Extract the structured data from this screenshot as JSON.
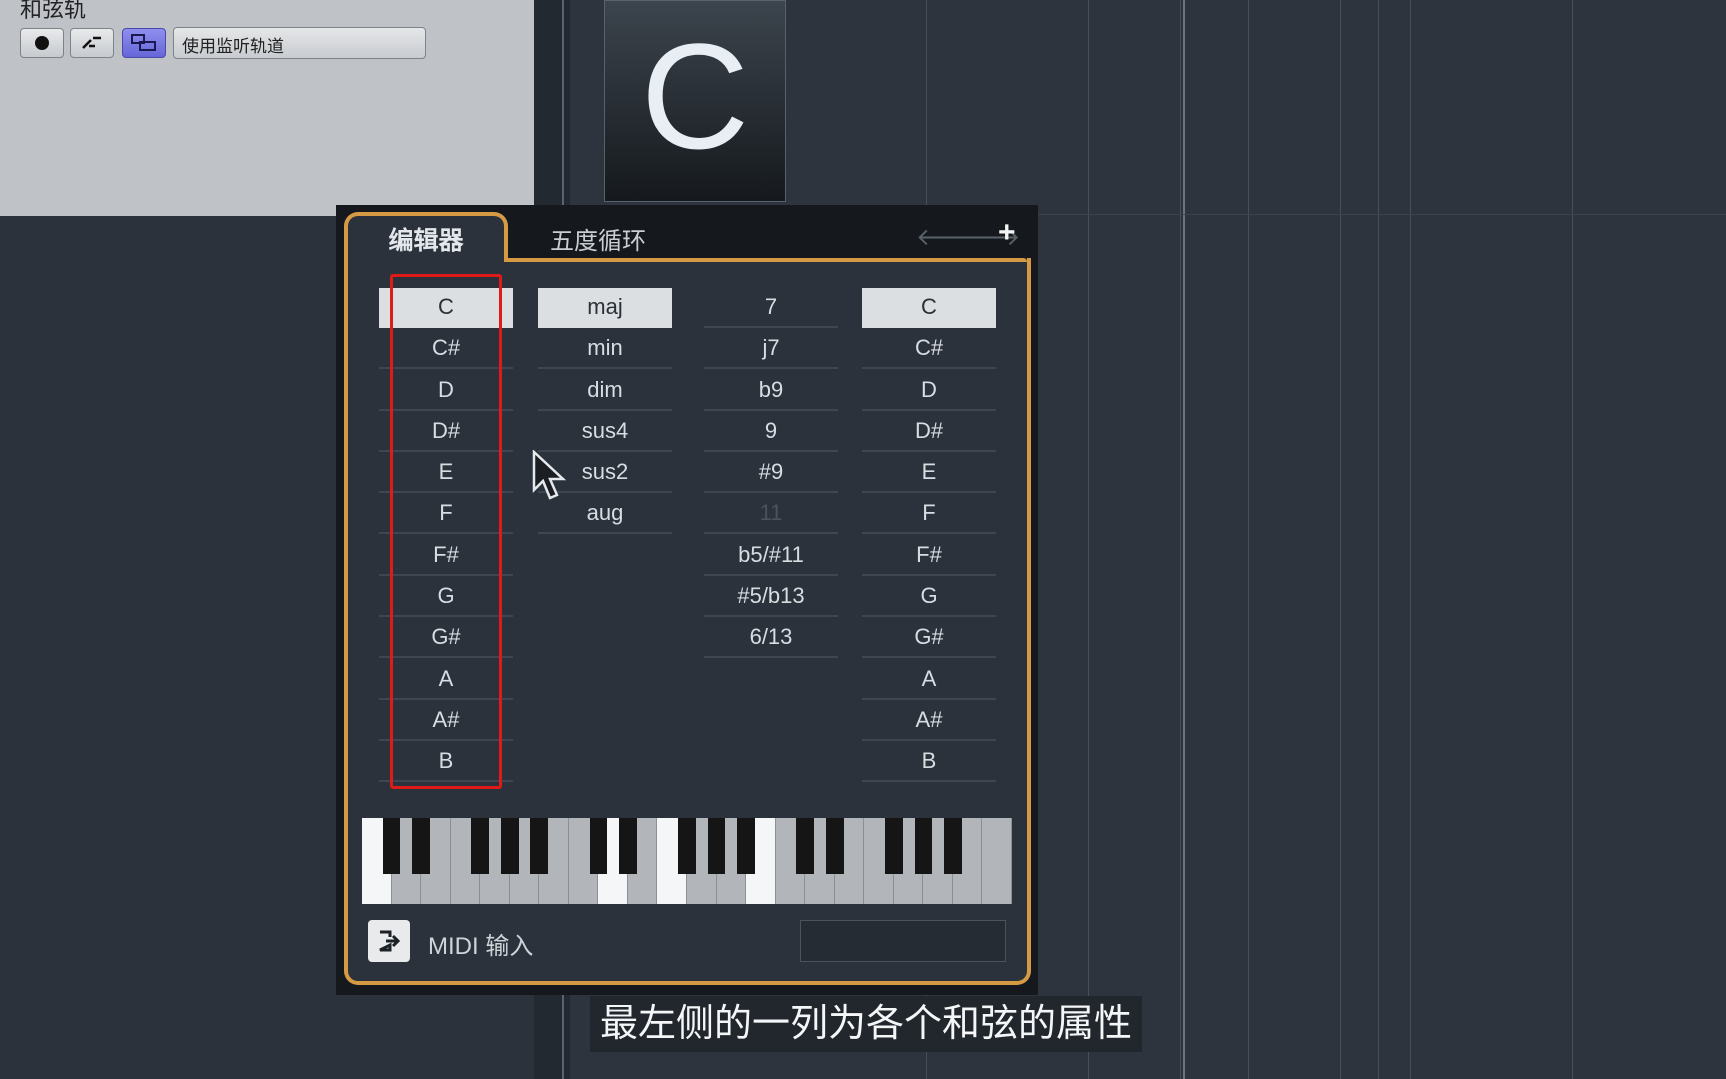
{
  "track_header": {
    "title": "和弦轨",
    "monitor_field": "使用监听轨道"
  },
  "chord_event": {
    "label": "C"
  },
  "editor": {
    "tabs": [
      {
        "label": "编辑器",
        "active": true
      },
      {
        "label": "五度循环",
        "active": false
      }
    ],
    "nav": {
      "back": "🡐",
      "forward": "🡒",
      "add": "+"
    },
    "root_notes": [
      "C",
      "C#",
      "D",
      "D#",
      "E",
      "F",
      "F#",
      "G",
      "G#",
      "A",
      "A#",
      "B"
    ],
    "root_selected": "C",
    "qualities": [
      "maj",
      "min",
      "dim",
      "sus4",
      "sus2",
      "aug"
    ],
    "quality_selected": "maj",
    "tensions": [
      "7",
      "j7",
      "b9",
      "9",
      "#9",
      "11",
      "b5/#11",
      "#5/b13",
      "6/13"
    ],
    "tension_disabled": "11",
    "bass_notes": [
      "C",
      "C#",
      "D",
      "D#",
      "E",
      "F",
      "F#",
      "G",
      "G#",
      "A",
      "A#",
      "B"
    ],
    "bass_selected": "C",
    "midi_input_label": "MIDI 输入",
    "midi_icon": "midi-input-icon",
    "accent_color": "#d69a45",
    "highlight_color": "#e01919"
  },
  "subtitle": "最左侧的一列为各个和弦的属性"
}
